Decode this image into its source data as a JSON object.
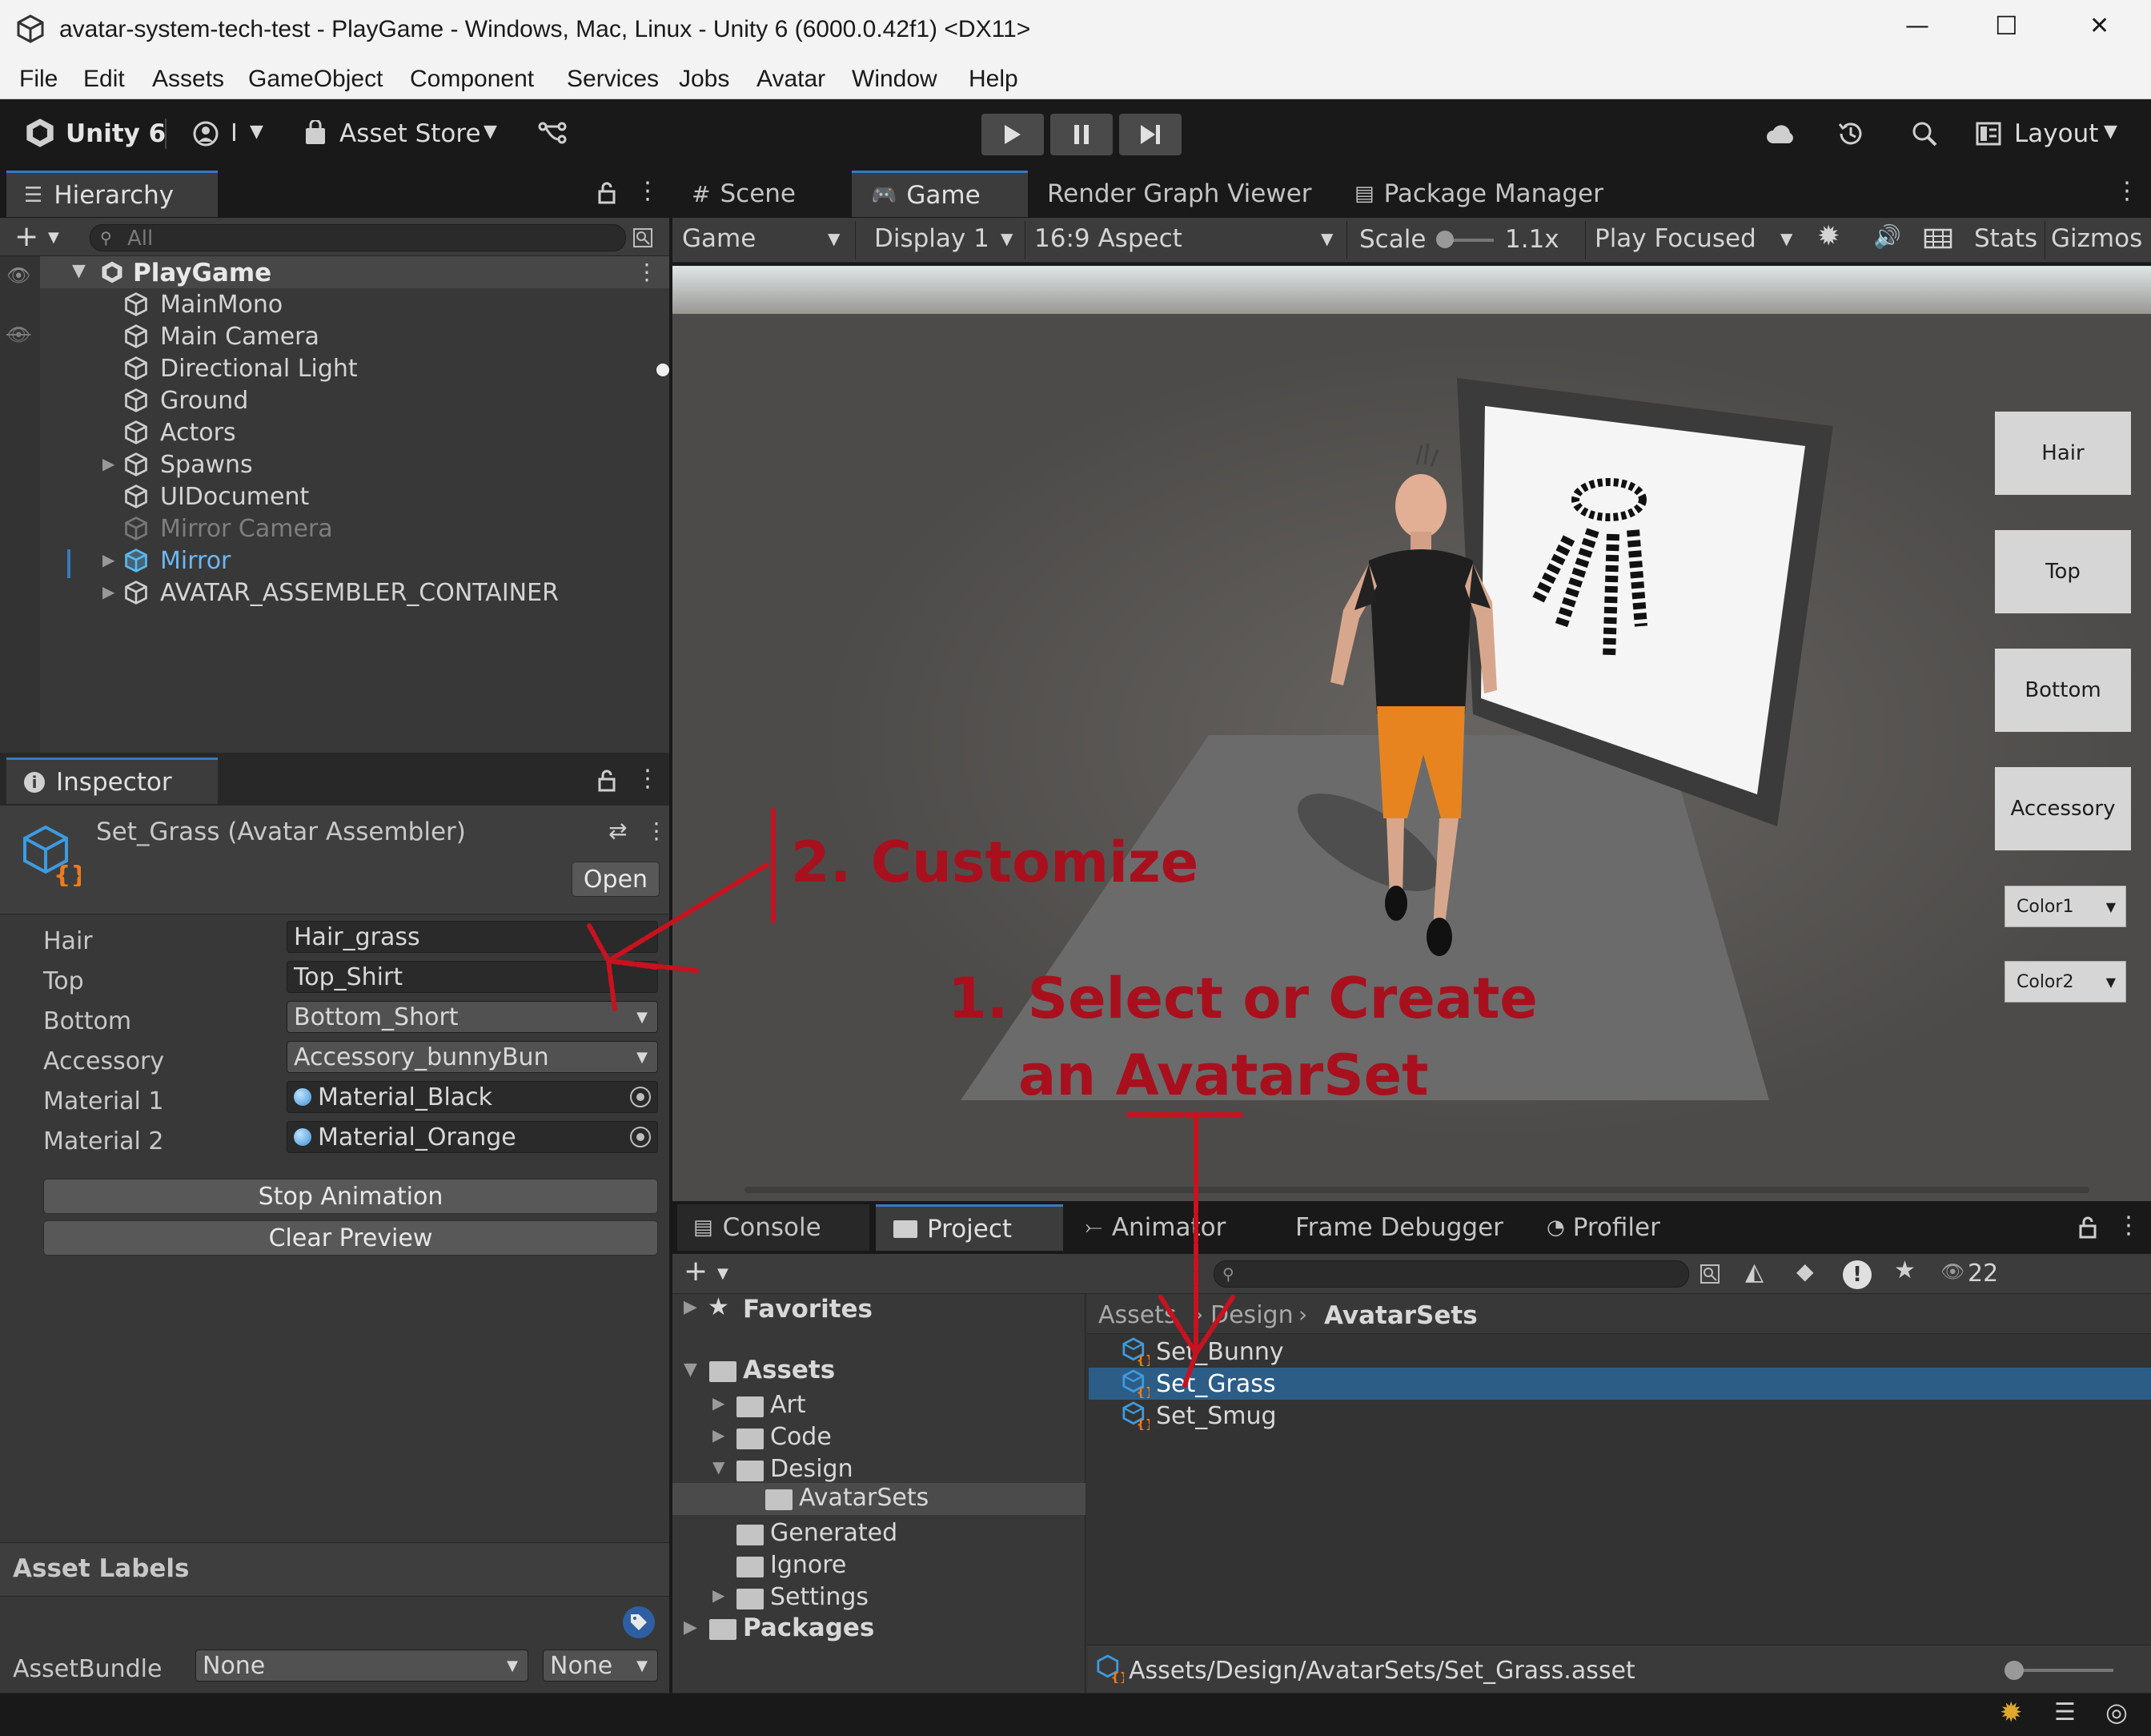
{
  "window": {
    "title": "avatar-system-tech-test - PlayGame - Windows, Mac, Linux - Unity 6 (6000.0.42f1) <DX11>",
    "minimize": "—",
    "maximize": "☐",
    "close": "✕"
  },
  "menu": [
    "File",
    "Edit",
    "Assets",
    "GameObject",
    "Component",
    "Services",
    "Jobs",
    "Avatar",
    "Window",
    "Help"
  ],
  "toolbar": {
    "brand": "Unity 6",
    "account_initial": "I",
    "asset_store": "Asset Store",
    "layout": "Layout"
  },
  "hierarchy": {
    "tab": "Hierarchy",
    "search_placeholder": "All",
    "scene": "PlayGame",
    "items": [
      "MainMono",
      "Main Camera",
      "Directional Light",
      "Ground",
      "Actors",
      "Spawns",
      "UIDocument",
      "Mirror Camera",
      "Mirror",
      "AVATAR_ASSEMBLER_CONTAINER"
    ]
  },
  "inspector": {
    "tab": "Inspector",
    "object_title": "Set_Grass (Avatar Assembler)",
    "open_button": "Open",
    "fields": [
      {
        "label": "Hair",
        "value": "Hair_grass"
      },
      {
        "label": "Top",
        "value": "Top_Shirt"
      },
      {
        "label": "Bottom",
        "value": "Bottom_Short"
      },
      {
        "label": "Accessory",
        "value": "Accessory_bunnyBun"
      },
      {
        "label": "Material 1",
        "value": "Material_Black"
      },
      {
        "label": "Material 2",
        "value": "Material_Orange"
      }
    ],
    "stop_animation": "Stop Animation",
    "clear_preview": "Clear Preview",
    "asset_labels": "Asset Labels",
    "assetbundle_label": "AssetBundle",
    "assetbundle_value": "None",
    "assetbundle_variant": "None"
  },
  "game_tabs": {
    "scene": "Scene",
    "game": "Game",
    "render_graph": "Render Graph Viewer",
    "package_manager": "Package Manager"
  },
  "game_toolbar": {
    "mode": "Game",
    "display": "Display 1",
    "aspect": "16:9 Aspect",
    "scale_label": "Scale",
    "scale_value": "1.1x",
    "play_mode": "Play Focused",
    "stats": "Stats",
    "gizmos": "Gizmos"
  },
  "game_ui": {
    "buttons": [
      "Hair",
      "Top",
      "Bottom",
      "Accessory"
    ],
    "dropdowns": [
      "Color1",
      "Color2"
    ]
  },
  "annotations": {
    "customize": "2. Customize",
    "select_line1": "1. Select or Create",
    "select_line2": "an AvatarSet"
  },
  "bottom_tabs": {
    "console": "Console",
    "project": "Project",
    "animator": "Animator",
    "frame_debugger": "Frame Debugger",
    "profiler": "Profiler",
    "hidden_count": "22"
  },
  "project": {
    "favorites": "Favorites",
    "assets": "Assets",
    "tree": [
      "Art",
      "Code",
      "Design",
      "AvatarSets",
      "Generated",
      "Ignore",
      "Settings"
    ],
    "packages": "Packages",
    "breadcrumb": [
      "Assets",
      "Design",
      "AvatarSets"
    ],
    "files": [
      "Set_Bunny",
      "Set_Grass",
      "Set_Smug"
    ],
    "selected_path": "Assets/Design/AvatarSets/Set_Grass.asset"
  },
  "colors": {
    "accent": "#3a79bb",
    "selection": "#2c5d87",
    "annotation": "#a8101e"
  }
}
